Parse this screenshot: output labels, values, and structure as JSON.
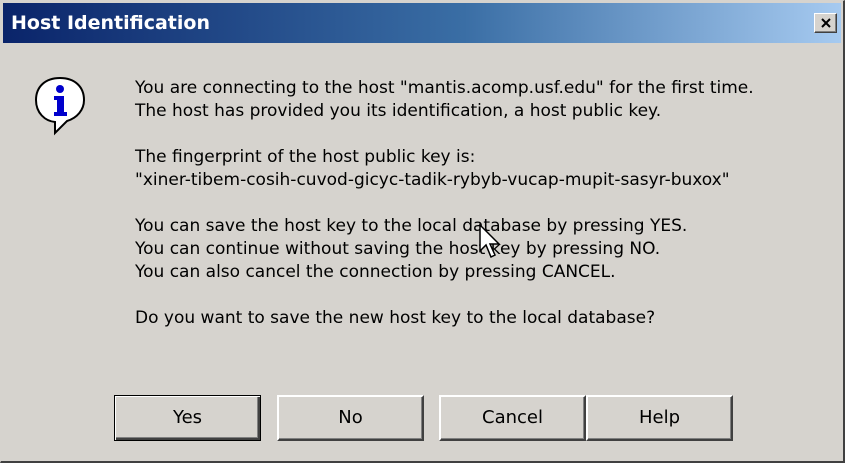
{
  "window": {
    "title": "Host Identification",
    "close_symbol": "×"
  },
  "icons": {
    "info": "info-icon",
    "close": "close-icon",
    "pointer": "mouse-pointer-icon"
  },
  "message": {
    "line1": "You are connecting to the host \"mantis.acomp.usf.edu\" for the first time.",
    "line2": "The host has provided you its identification, a host public key.",
    "line3": "The fingerprint of the host public key is:",
    "line4": "\"xiner-tibem-cosih-cuvod-gicyc-tadik-rybyb-vucap-mupit-sasyr-buxox\"",
    "line5": "You can save the host key to the local database by pressing YES.",
    "line6": "You can continue without saving the host key by pressing NO.",
    "line7": "You can also cancel the connection by pressing CANCEL.",
    "line8": "Do you want to save the new host key to the local database?"
  },
  "buttons": {
    "yes": "Yes",
    "no": "No",
    "cancel": "Cancel",
    "help": "Help"
  },
  "colors": {
    "titlebar_start": "#0a246a",
    "titlebar_end": "#a6caf0",
    "dialog_face": "#d6d3ce",
    "info_icon": "#0000cc"
  }
}
